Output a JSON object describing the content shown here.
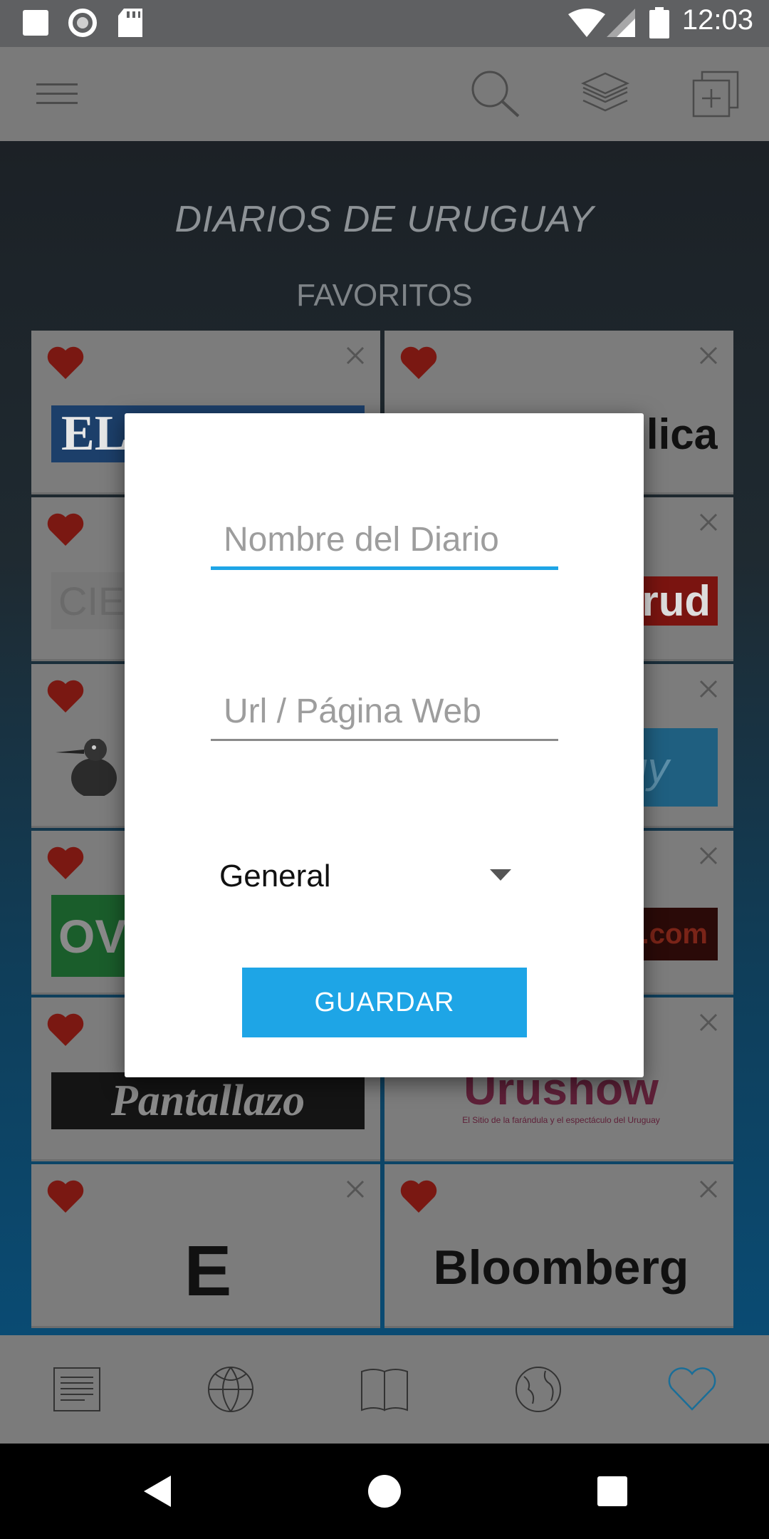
{
  "status_bar": {
    "time": "12:03"
  },
  "app_bar": {
    "menu_icon": "menu-icon",
    "search_icon": "search-icon",
    "layers_icon": "layers-icon",
    "add_icon": "add-box-icon"
  },
  "main": {
    "title": "DIARIOS DE URUGUAY",
    "section": "FAVORITOS",
    "cards": [
      {
        "logo_text": "EL"
      },
      {
        "logo_text": "lica"
      },
      {
        "logo_text": "CIE"
      },
      {
        "logo_text": "rud"
      },
      {
        "logo_text": ""
      },
      {
        "logo_text": "uy"
      },
      {
        "logo_text": "OV"
      },
      {
        "logo_text": ".com"
      },
      {
        "logo_text": "Pantallazo"
      },
      {
        "logo_text": "Urushow",
        "logo_subtext": "El Sitio de la farándula y el espectáculo del Uruguay"
      },
      {
        "logo_text": "E"
      },
      {
        "logo_text": "Bloomberg"
      }
    ]
  },
  "dialog": {
    "name_placeholder": "Nombre del Diario",
    "url_placeholder": "Url / Página Web",
    "category_value": "General",
    "save_label": "GUARDAR"
  },
  "bottom_nav": {
    "items": [
      "news-icon",
      "basketball-icon",
      "book-icon",
      "globe-icon",
      "heart-outline-icon"
    ],
    "active": "heart-outline-icon",
    "accent": "#1ea5e6"
  },
  "colors": {
    "accent": "#1ea5e6",
    "heart": "#8b1a14"
  }
}
